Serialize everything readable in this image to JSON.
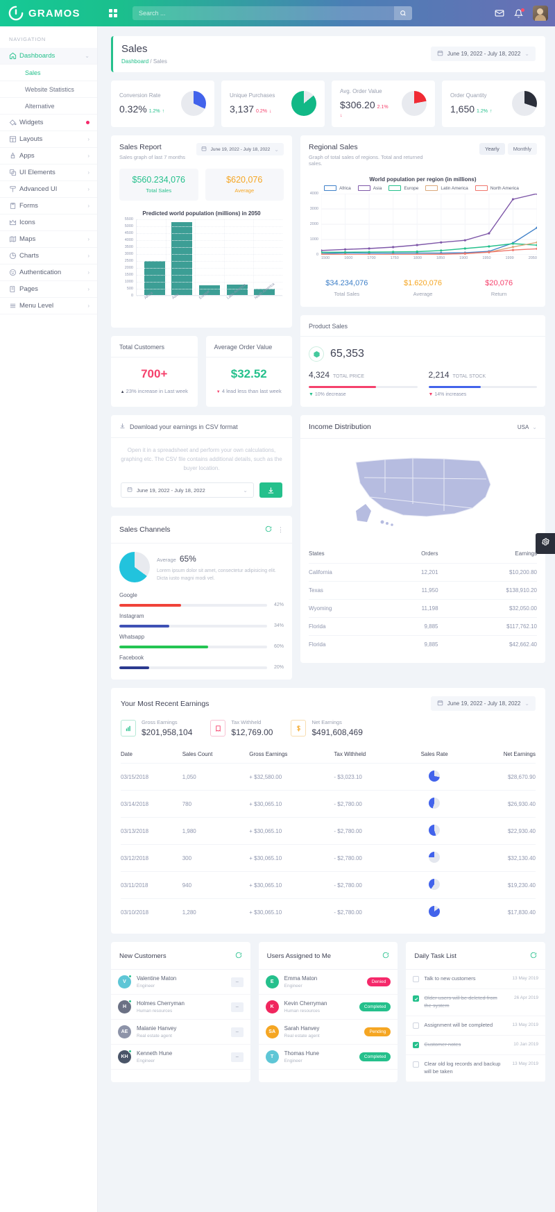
{
  "brand": {
    "name": "GRAMOS",
    "logo_icon": "circle-swirl-logo"
  },
  "topbar": {
    "grid_icon": "apps-grid-icon",
    "search_placeholder": "Search ...",
    "search_value": "",
    "search_icon": "search-icon",
    "mail_icon": "envelope-icon",
    "bell_icon": "bell-icon",
    "avatar": "user-avatar"
  },
  "sidebar": {
    "section_title": "NAVIGATION",
    "items": [
      {
        "label": "Dashboards",
        "icon": "home-icon",
        "active": true,
        "chevron": "chevron-down"
      },
      {
        "label": "Widgets",
        "icon": "paint-bucket-icon",
        "dot": true
      },
      {
        "label": "Layouts",
        "icon": "layout-icon",
        "chevron": "chevron-right"
      },
      {
        "label": "Apps",
        "icon": "apps-icon",
        "chevron": "chevron-right"
      },
      {
        "label": "UI Elements",
        "icon": "layers-icon",
        "chevron": "chevron-right"
      },
      {
        "label": "Advanced UI",
        "icon": "advanced-icon",
        "chevron": "chevron-right"
      },
      {
        "label": "Forms",
        "icon": "clipboard-icon",
        "chevron": "chevron-right"
      },
      {
        "label": "Icons",
        "icon": "crown-icon"
      },
      {
        "label": "Maps",
        "icon": "map-icon",
        "chevron": "chevron-right"
      },
      {
        "label": "Charts",
        "icon": "pie-chart-icon",
        "chevron": "chevron-right"
      },
      {
        "label": "Authentication",
        "icon": "smiley-icon",
        "chevron": "chevron-right"
      },
      {
        "label": "Pages",
        "icon": "pages-icon",
        "chevron": "chevron-right"
      },
      {
        "label": "Menu Level",
        "icon": "menu-icon",
        "chevron": "chevron-right"
      }
    ],
    "sub_items": [
      {
        "label": "Sales",
        "active": true
      },
      {
        "label": "Website Statistics",
        "active": false
      },
      {
        "label": "Alternative",
        "active": false
      }
    ]
  },
  "page": {
    "title": "Sales",
    "breadcrumb_root": "Dashboard",
    "breadcrumb_sep": "/",
    "breadcrumb_current": "Sales",
    "date_range": "June 19, 2022 - July 18, 2022"
  },
  "kpi_cards": [
    {
      "label": "Conversion Rate",
      "value": "0.32%",
      "delta": "1.2%",
      "dir": "up",
      "arrow": "↑",
      "color": "#4263eb",
      "pct": 32
    },
    {
      "label": "Unique Purchases",
      "value": "3,137",
      "delta": "0.2%",
      "dir": "down",
      "arrow": "↓",
      "color": "#11b886",
      "pct": 72
    },
    {
      "label": "Avg. Order Value",
      "value": "$306.20",
      "delta": "2.1%",
      "dir": "down",
      "arrow": "↓",
      "color": "#f02b34",
      "pct": 22
    },
    {
      "label": "Order Quantity",
      "value": "1,650",
      "delta": "1.2%",
      "dir": "up",
      "arrow": "↑",
      "color": "#2b2f3a",
      "pct": 30
    }
  ],
  "sales_report": {
    "title": "Sales Report",
    "subtitle": "Sales graph of last 7 months",
    "date_range": "June 19, 2022 - July 18, 2022",
    "total_sales_value": "$560.234,076",
    "total_sales_label": "Total Sales",
    "average_value": "$620,076",
    "average_label": "Average"
  },
  "regional_sales": {
    "title": "Regional Sales",
    "subtitle": "Graph of total sales of regions. Total and returned sales.",
    "tabs": [
      {
        "label": "Yearly",
        "active": true
      },
      {
        "label": "Monthly",
        "active": false
      }
    ],
    "stats": [
      {
        "value": "$34.234,076",
        "label": "Total Sales",
        "color": "#3f80c8"
      },
      {
        "value": "$1.620,076",
        "label": "Average",
        "color": "#f5a623"
      },
      {
        "value": "$20,076",
        "label": "Return",
        "color": "#f5416c"
      }
    ]
  },
  "total_customers": {
    "title": "Total Customers",
    "value": "700+",
    "note": "23% increase in Last week",
    "arrow": "▲"
  },
  "average_order_value": {
    "title": "Average Order Value",
    "value": "$32.52",
    "note": "4 lead less than last week",
    "arrow": "▼"
  },
  "csv": {
    "title": "Download your earnings in CSV format",
    "download_icon": "download-icon",
    "description": "Open it in a spreadsheet and perform your own calculations, graphing etc. The CSV file contains additional details, such as the buyer location.",
    "date_range": "June 19, 2022 - July 18, 2022",
    "button_icon": "download-arrow-icon"
  },
  "sales_channels": {
    "title": "Sales Channels",
    "refresh_icon": "refresh-icon",
    "more_icon": "more-vertical-icon",
    "average_label": "Average",
    "average_value": "65%",
    "description": "Lorem ipsum dolor sit amet, consectetur adipisicing elit. Dicta iusto magni modi vel.",
    "channels": [
      {
        "name": "Google",
        "pct": "42%",
        "value": 42,
        "color": "#f0433a"
      },
      {
        "name": "Instagram",
        "pct": "34%",
        "value": 34,
        "color": "#3f51b5"
      },
      {
        "name": "Whatsapp",
        "pct": "60%",
        "value": 60,
        "color": "#23c552"
      },
      {
        "name": "Facebook",
        "pct": "20%",
        "value": 20,
        "color": "#2b3a8f"
      }
    ]
  },
  "product_sales": {
    "title": "Product Sales",
    "icon": "box-icon",
    "total": "65,353",
    "metrics": [
      {
        "value": "4,324",
        "label": "TOTAL PRICE",
        "bar_pct": 62,
        "bar_color": "#f5416c",
        "note": "10% decrease",
        "note_color": "#25c08c",
        "arrow": "▼"
      },
      {
        "value": "2,214",
        "label": "TOTAL STOCK",
        "bar_pct": 48,
        "bar_color": "#4263eb",
        "note": "14% increases",
        "note_color": "#f5416c",
        "arrow": "▼"
      }
    ]
  },
  "income_distribution": {
    "title": "Income Distribution",
    "region": "USA",
    "chevron": "chevron-down-icon",
    "columns": [
      "States",
      "Orders",
      "Earnings"
    ],
    "rows": [
      {
        "state": "California",
        "orders": "12,201",
        "earnings": "$10,200.80"
      },
      {
        "state": "Texas",
        "orders": "11,950",
        "earnings": "$138,910.20"
      },
      {
        "state": "Wyoming",
        "orders": "11,198",
        "earnings": "$32,050.00"
      },
      {
        "state": "Florida",
        "orders": "9,885",
        "earnings": "$117,762.10"
      },
      {
        "state": "Florida",
        "orders": "9,885",
        "earnings": "$42,662.40"
      }
    ]
  },
  "recent_earnings": {
    "title": "Your Most Recent Earnings",
    "date_range": "June 19, 2022 - July 18, 2022",
    "kpis": [
      {
        "label": "Gross Earnings",
        "value": "$201,958,104",
        "icon": "bar-chart-icon",
        "color": "#25c08c"
      },
      {
        "label": "Tax Withheld",
        "value": "$12,769.00",
        "icon": "receipt-icon",
        "color": "#f5416c"
      },
      {
        "label": "Net Earnings",
        "value": "$491,608,469",
        "icon": "dollar-icon",
        "color": "#f5a623"
      }
    ],
    "columns": [
      "Date",
      "Sales Count",
      "Gross Earnings",
      "Tax Withheld",
      "Sales Rate",
      "Net Earnings"
    ],
    "rows": [
      {
        "date": "03/15/2018",
        "count": "1,050",
        "gross": "+ $32,580.00",
        "tax": "- $3,023.10",
        "rate": 72,
        "net": "$28,670.90"
      },
      {
        "date": "03/14/2018",
        "count": "780",
        "gross": "+ $30,065.10",
        "tax": "- $2,780.00",
        "rate": 45,
        "net": "$26,930.40"
      },
      {
        "date": "03/13/2018",
        "count": "1,980",
        "gross": "+ $30,065.10",
        "tax": "- $2,780.00",
        "rate": 55,
        "net": "$22,930.40"
      },
      {
        "date": "03/12/2018",
        "count": "300",
        "gross": "+ $30,065.10",
        "tax": "- $2,780.00",
        "rate": 25,
        "net": "$32,130.40"
      },
      {
        "date": "03/11/2018",
        "count": "940",
        "gross": "+ $30,065.10",
        "tax": "- $2,780.00",
        "rate": 40,
        "net": "$19,230.40"
      },
      {
        "date": "03/10/2018",
        "count": "1,280",
        "gross": "+ $30,065.10",
        "tax": "- $2,780.00",
        "rate": 85,
        "net": "$17,830.40"
      }
    ]
  },
  "new_customers": {
    "title": "New Customers",
    "refresh_icon": "refresh-icon",
    "rows": [
      {
        "initials": "V",
        "name": "Valentine Maton",
        "role": "Engineer",
        "color": "#5ec6d6",
        "online": true,
        "action": "−"
      },
      {
        "initials": "H",
        "name": "Holmes Cherryman",
        "role": "Human resources",
        "color": "#6b7184",
        "online": true,
        "action": "−"
      },
      {
        "initials": "AE",
        "name": "Malanie Hanvey",
        "role": "Real estate agent",
        "color": "#8d93a8",
        "online": false,
        "action": "−"
      },
      {
        "initials": "KH",
        "name": "Kenneth Hune",
        "role": "Engineer",
        "color": "#4a5568",
        "online": true,
        "action": "−"
      }
    ]
  },
  "users_assigned": {
    "title": "Users Assigned to Me",
    "refresh_icon": "refresh-icon",
    "rows": [
      {
        "initials": "E",
        "name": "Emma Maton",
        "role": "Engineer",
        "color": "#25c08c",
        "badge": "Denied",
        "badge_color": "#f5296a"
      },
      {
        "initials": "K",
        "name": "Kevin Cherryman",
        "role": "Human resources",
        "color": "#f0265e",
        "badge": "Completed",
        "badge_color": "#25c08c"
      },
      {
        "initials": "SA",
        "name": "Sarah Hanvey",
        "role": "Real estate agent",
        "color": "#f5a623",
        "badge": "Pending",
        "badge_color": "#f5a623"
      },
      {
        "initials": "T",
        "name": "Thomas Hune",
        "role": "Engineer",
        "color": "#5ec6d6",
        "badge": "Completed",
        "badge_color": "#25c08c"
      }
    ]
  },
  "daily_tasks": {
    "title": "Daily Task List",
    "refresh_icon": "refresh-icon",
    "rows": [
      {
        "text": "Talk to new customers",
        "done": false,
        "date": "13 May 2019"
      },
      {
        "text": "Older users will be deleted from the system",
        "done": true,
        "date": "26 Apr 2019"
      },
      {
        "text": "Assignment will be completed",
        "done": false,
        "date": "13 May 2019"
      },
      {
        "text": "Customer notes",
        "done": true,
        "date": "10 Jan 2019"
      },
      {
        "text": "Clear old log records and backup will be taken",
        "done": false,
        "date": "13 May 2019"
      }
    ]
  },
  "settings_tab": {
    "icon": "gear-icon"
  },
  "chart_data": [
    {
      "type": "bar",
      "title": "Predicted world population (millions) in 2050",
      "categories": [
        "Africa",
        "Asia",
        "Europe",
        "Latin America",
        "North America"
      ],
      "values": [
        2450,
        5250,
        700,
        750,
        450
      ],
      "ylim": [
        0,
        5500
      ],
      "yticks": [
        0,
        500,
        1000,
        1500,
        2000,
        2500,
        3000,
        3500,
        4000,
        4500,
        5000,
        5500
      ],
      "xlabel": "",
      "ylabel": "",
      "grid": true,
      "series_color": "#3c9e95"
    },
    {
      "type": "line",
      "title": "World population per region (in millions)",
      "x": [
        1500,
        1600,
        1700,
        1750,
        1800,
        1850,
        1900,
        1950,
        1999,
        2050
      ],
      "xlabels": [
        "1500",
        "1600",
        "1700",
        "1750",
        "1800",
        "1850",
        "1900",
        "1950",
        "1999",
        "2050"
      ],
      "ylim": [
        0,
        4000
      ],
      "yticks": [
        0,
        1000,
        2000,
        3000,
        4000
      ],
      "grid": true,
      "legend_position": "top",
      "series": [
        {
          "name": "Africa",
          "color": "#3f80c8",
          "values": [
            86,
            114,
            106,
            106,
            107,
            111,
            133,
            221,
            767,
            1766
          ]
        },
        {
          "name": "Asia",
          "color": "#7e57a8",
          "values": [
            282,
            350,
            411,
            502,
            635,
            809,
            947,
            1402,
            3634,
            5268
          ]
        },
        {
          "name": "Europe",
          "color": "#25c08c",
          "values": [
            168,
            170,
            178,
            190,
            203,
            276,
            408,
            547,
            729,
            628
          ]
        },
        {
          "name": "Latin America",
          "color": "#dba87a",
          "values": [
            40,
            20,
            10,
            16,
            24,
            38,
            74,
            167,
            511,
            809
          ]
        },
        {
          "name": "North America",
          "color": "#f0766c",
          "values": [
            6,
            3,
            2,
            2,
            7,
            26,
            82,
            172,
            307,
            392
          ]
        }
      ]
    }
  ]
}
